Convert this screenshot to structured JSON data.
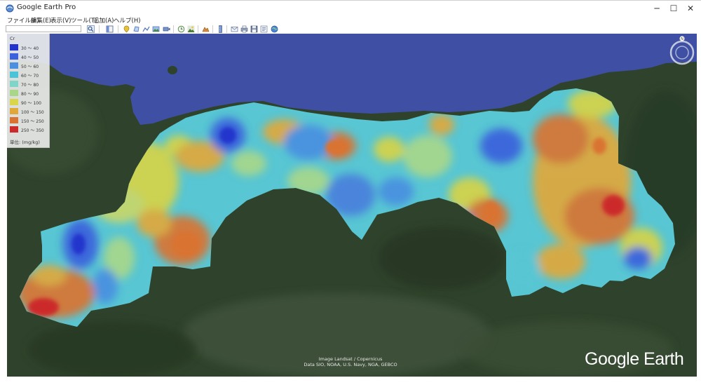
{
  "window": {
    "title": "Google Earth Pro",
    "minimize_icon": "─",
    "maximize_icon": "☐",
    "close_icon": "✕"
  },
  "menu": [
    "ファイル(F)",
    "編集(E)",
    "表示(V)",
    "ツール(T)",
    "追加(A)",
    "ヘルプ(H)"
  ],
  "toolbar": {
    "search_value": "",
    "icons": [
      "search-icon",
      "sidebar-icon",
      "placemark-icon",
      "polygon-icon",
      "path-icon",
      "image-overlay-icon",
      "record-tour-icon",
      "history-icon",
      "sun-icon",
      "planets-icon",
      "ruler-icon",
      "email-icon",
      "print-icon",
      "save-image-icon",
      "map-view-icon",
      "google-earth-icon"
    ]
  },
  "legend": {
    "title": "Cr",
    "items": [
      {
        "label": "30 ～ 40",
        "color": "#2334cc"
      },
      {
        "label": "40 ～ 50",
        "color": "#3b61dc"
      },
      {
        "label": "50 ～ 60",
        "color": "#4a8fe0"
      },
      {
        "label": "60 ～ 70",
        "color": "#4bc4d9"
      },
      {
        "label": "70 ～ 80",
        "color": "#7fd6c8"
      },
      {
        "label": "80 ～ 90",
        "color": "#a8d78a"
      },
      {
        "label": "90 ～ 100",
        "color": "#d9d64a"
      },
      {
        "label": "100 ～ 150",
        "color": "#e0a83a"
      },
      {
        "label": "150 ～ 250",
        "color": "#d97333"
      },
      {
        "label": "250 ～ 350",
        "color": "#cc2b2b"
      }
    ],
    "unit": "単位: (mg/kg)"
  },
  "map": {
    "attribution_line1": "Image Landsat / Copernicus",
    "attribution_line2": "Data SIO, NOAA, U.S. Navy, NGA, GEBCO",
    "logo": "Google Earth"
  },
  "colors": {
    "sea": "#3f4fa3",
    "land": "#34472f"
  }
}
